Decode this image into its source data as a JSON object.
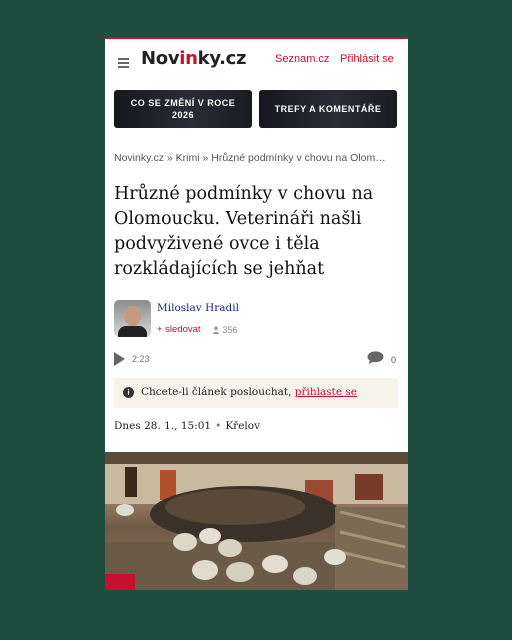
{
  "header": {
    "logo": {
      "prefix": "Nov",
      "accent": "in",
      "suffix": "ky.cz"
    },
    "seznam": "Seznam.cz",
    "login": "Přihlásit se"
  },
  "promos": [
    {
      "line1": "CO SE ZMĚNÍ V ROCE",
      "line2": "2026"
    },
    {
      "line1": "TREFY A KOMENTÁŘE",
      "line2": ""
    }
  ],
  "breadcrumb": "Novinky.cz » Krimi » Hrůzné podmínky v chovu na Olom…",
  "headline": "Hrůzné podmínky v chovu na Olomoucku. Veterináři našli podvyživené ovce i těla rozkládajících se jehňat",
  "author": {
    "name": "Miloslav Hradil",
    "follow": "+ sledovat",
    "followers": "356"
  },
  "audio": {
    "duration": "2:23"
  },
  "comments": {
    "count": "0"
  },
  "listen": {
    "text": "Chcete-li článek poslouchat, ",
    "link": "přihlaste se"
  },
  "dateline": {
    "date": "Dnes 28. 1., 15:01",
    "place": "Křelov"
  },
  "icons": [
    "menu-icon",
    "play-icon",
    "comment-icon",
    "info-icon",
    "person-icon"
  ],
  "colors": {
    "accent": "#c8102e",
    "background": "#1f4d3f"
  }
}
